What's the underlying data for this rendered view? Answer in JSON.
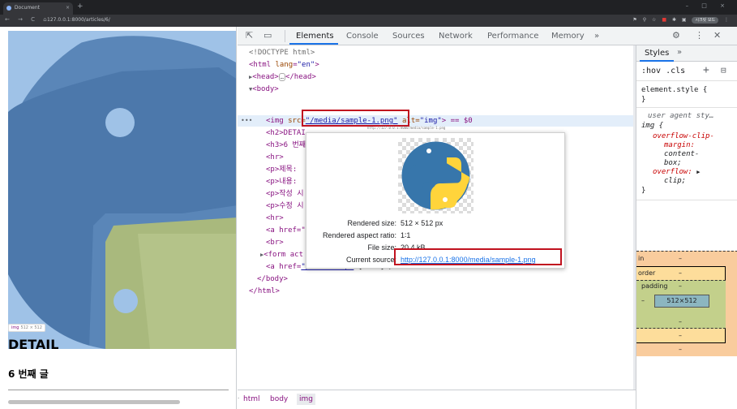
{
  "browser": {
    "tab_title": "Document",
    "tab_close": "×",
    "new_tab": "+",
    "window_controls": "– □ ×",
    "nav_buttons": "← → C ⌂",
    "url": "127.0.0.1:8000/articles/6/",
    "profile_label": "시크릿 모드"
  },
  "page": {
    "badge_tag": "img",
    "badge_dims": "512 × 512",
    "detail_heading": "DETAIL",
    "post_heading": "6 번째 글"
  },
  "devtools": {
    "tabs": [
      "Elements",
      "Console",
      "Sources",
      "Network",
      "Performance",
      "Memory"
    ],
    "more_tabs": "»",
    "active_tab": "Elements",
    "dom": {
      "doctype": "<!DOCTYPE html>",
      "html_open": "<html",
      "html_attr": "lang",
      "html_val": "\"en\"",
      "head": "<head>",
      "head_ellipsis": "…",
      "head_close": "</head>",
      "body_open": "<body>",
      "img_tag": "<img",
      "img_src_attr": "src=",
      "img_src_val": "\"/media/sample-1.png\"",
      "img_alt_attr": "alt=",
      "img_alt_val": "\"img\"",
      "img_eq": "> == $0",
      "h2_line": "<h2>DETAI",
      "h3_line": "<h3>6 번째",
      "hr_line": "<hr>",
      "p1_line": "<p>제목:",
      "p2_line": "<p>내용:",
      "p3_line": "<p>작성 시",
      "p4_line": "<p>수정 시",
      "hr2_line": "<hr>",
      "a_line": "<a href=\"",
      "br_line": "<br>",
      "form_line": "<form act",
      "a2_open": "<a href=",
      "a2_val": "\"/articles/\"",
      "a2_text": ">[back]</a>",
      "body_close": "</body>",
      "html_close": "</html>"
    },
    "tooltip": {
      "rendered_size_label": "Rendered size:",
      "rendered_size_value": "512 × 512 px",
      "aspect_label": "Rendered aspect ratio:",
      "aspect_value": "1∶1",
      "file_size_label": "File size:",
      "file_size_value": "20.4 kB",
      "current_source_label": "Current source:",
      "current_source_value": "http://127.0.0.1:8000/media/sample-1.png",
      "tiny_url": "http://127.0.0.1:8000/media/sample-1.png"
    },
    "breadcrumbs": [
      "html",
      "body",
      "img"
    ],
    "styles": {
      "tab": "Styles",
      "more": "»",
      "hov_cls": ":hov .cls",
      "element_style": "element.style {",
      "close_brace": "}",
      "user_agent": "user agent sty…",
      "img_selector": "img {",
      "prop1": "overflow-clip-",
      "prop1b": "margin:",
      "val1": "content-",
      "val1b": "box;",
      "prop2": "overflow:",
      "val2": "clip;",
      "box_margin_label": "in",
      "box_border_label": "order",
      "box_padding_label": "padding",
      "box_content": "512×512",
      "dash": "–"
    }
  }
}
